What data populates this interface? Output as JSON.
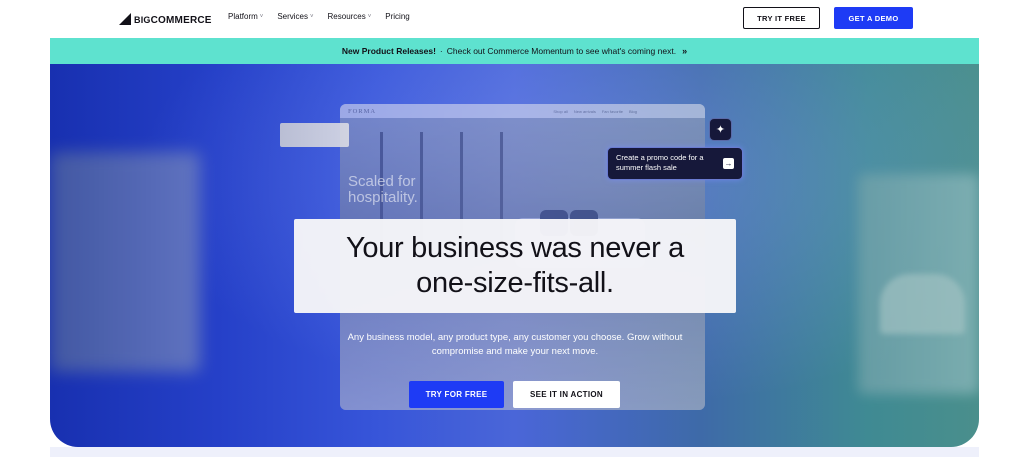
{
  "nav": {
    "logo_big": "BIG",
    "logo_rest": "COMMERCE",
    "links": [
      {
        "label": "Platform",
        "has_menu": true
      },
      {
        "label": "Services",
        "has_menu": true
      },
      {
        "label": "Resources",
        "has_menu": true
      },
      {
        "label": "Pricing",
        "has_menu": false
      }
    ],
    "chevron": "˅",
    "try_label": "TRY IT FREE",
    "demo_label": "GET A DEMO"
  },
  "banner": {
    "bold": "New Product Releases!",
    "separator": "·",
    "text": "Check out Commerce Momentum to see what's coming next.",
    "arrow": "»",
    "bg_color": "#5ee2cf"
  },
  "storefront": {
    "brand": "FORMA",
    "menu": [
      "Shop all",
      "New arrivals",
      "Fan favorite",
      "Blog"
    ],
    "overlay_text_1": "Scaled for",
    "overlay_text_2": "hospitality."
  },
  "ai": {
    "sparkle_icon": "✦",
    "prompt_line_1": "Create a promo code for a",
    "prompt_line_2": "summer flash sale",
    "send_icon": "→"
  },
  "hero": {
    "headline_line_1": "Your business was never a",
    "headline_line_2": "one-size-fits-all.",
    "sub_line_1": "Any business model, any product type, any customer you choose. Grow without",
    "sub_line_2": "compromise and make your next move.",
    "try_label": "TRY FOR FREE",
    "see_label": "SEE IT IN ACTION"
  },
  "colors": {
    "accent": "#1e3bf5",
    "banner": "#5ee2cf",
    "text": "#121118"
  }
}
